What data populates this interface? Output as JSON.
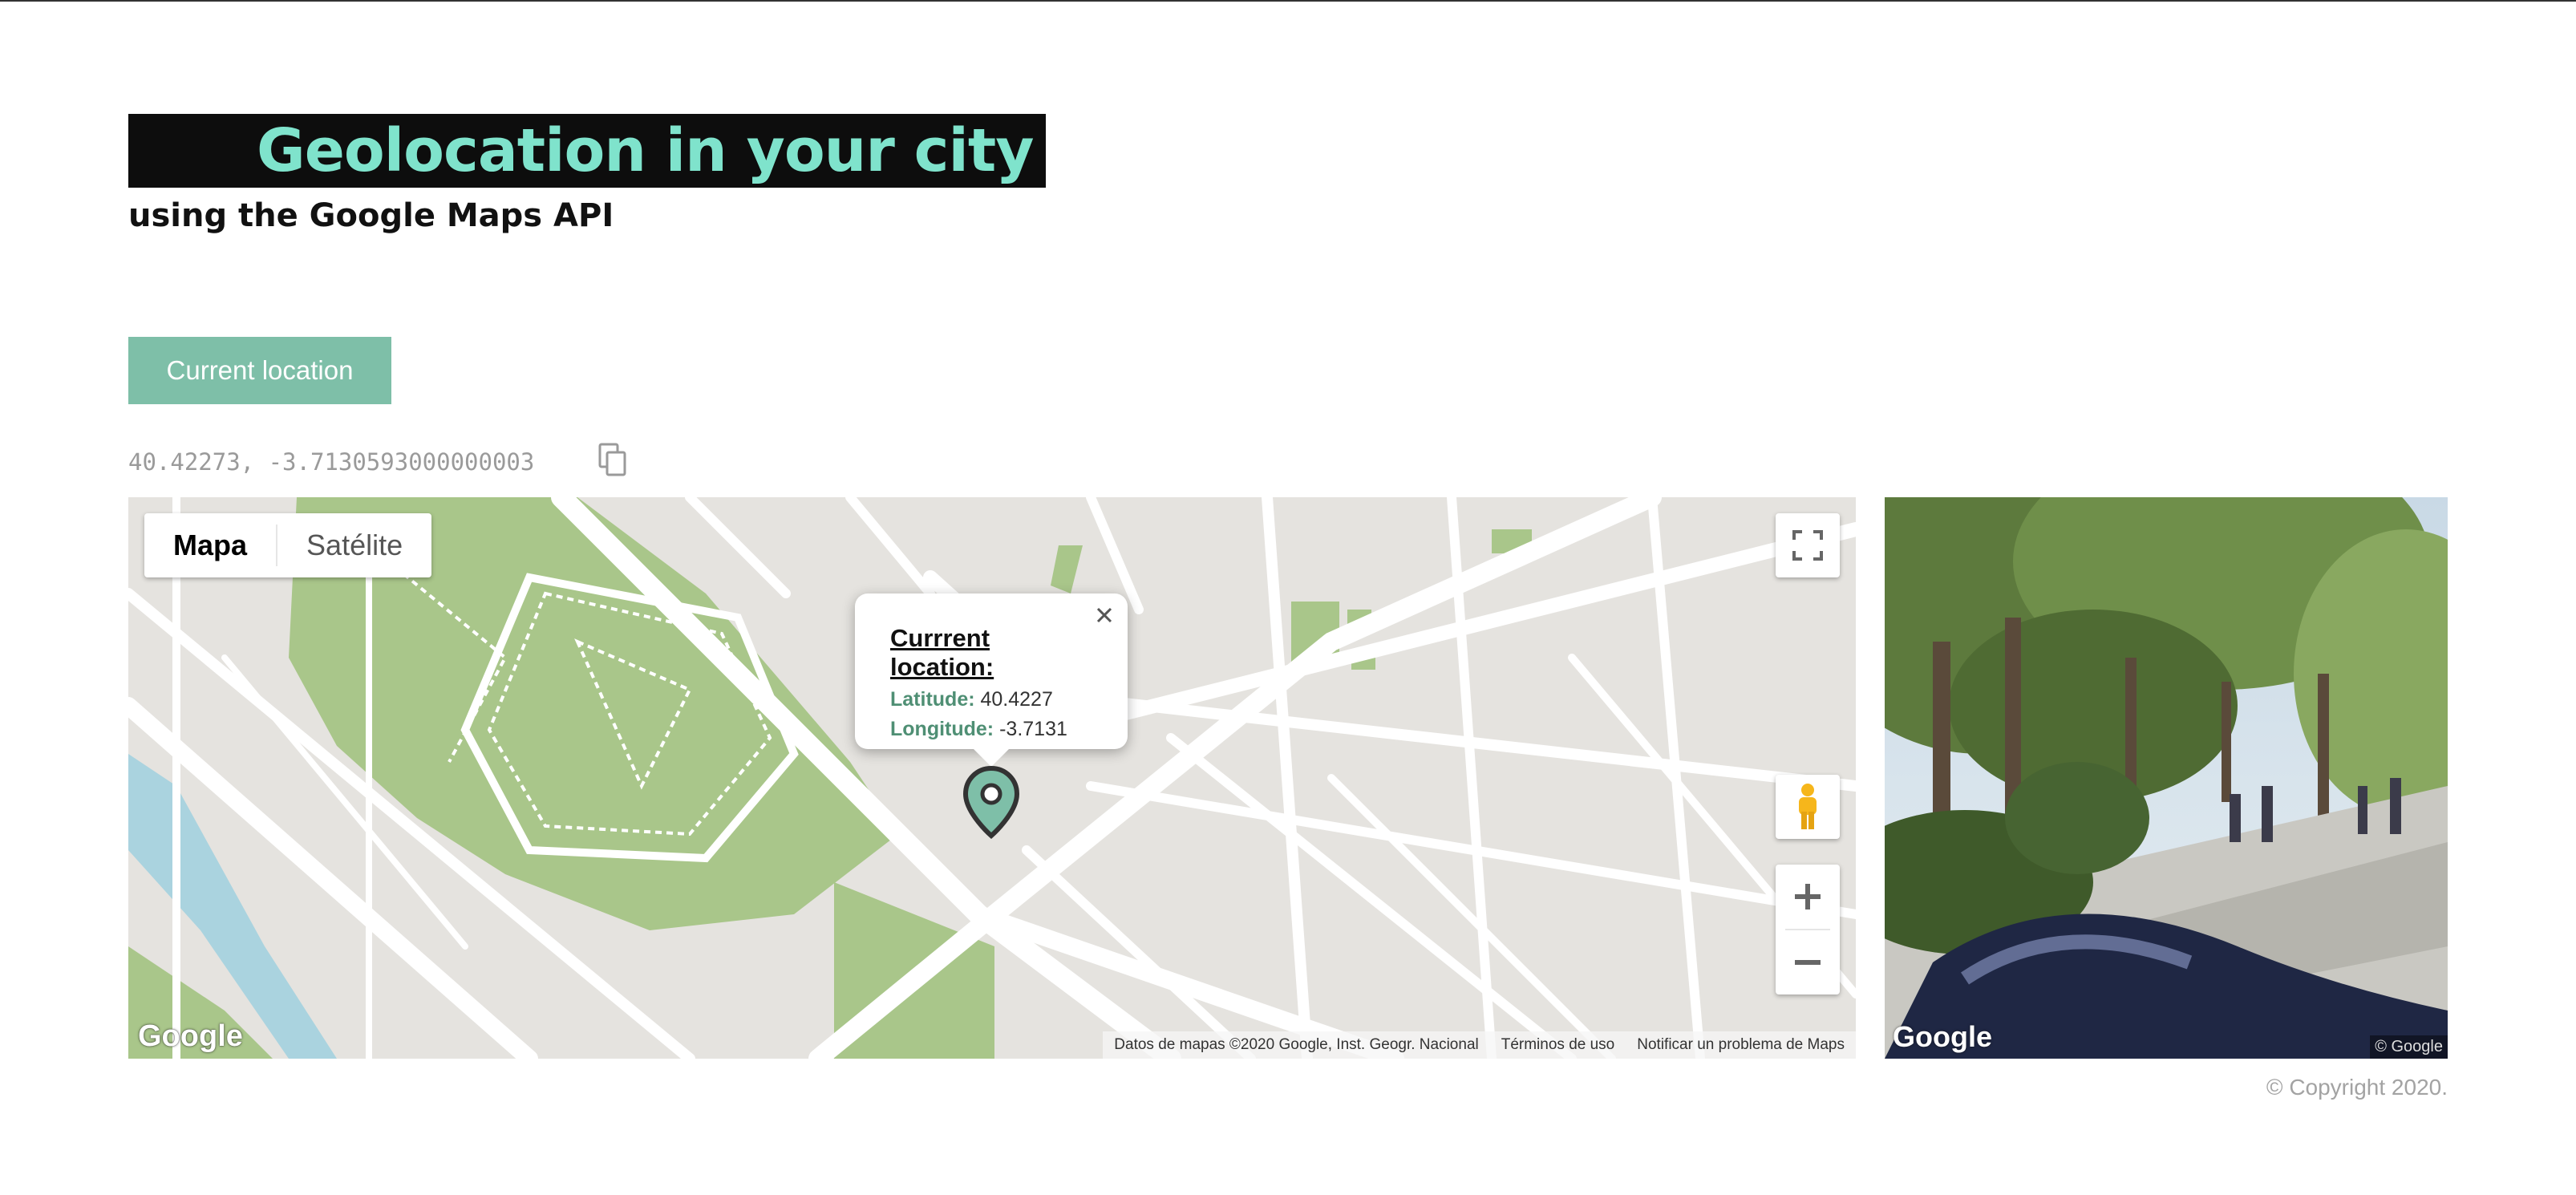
{
  "header": {
    "title": "Geolocation in your city",
    "subtitle": "using the Google Maps API"
  },
  "controls": {
    "current_location_label": "Current location",
    "coordinates_text": "40.42273, -3.7130593000000003"
  },
  "map": {
    "type_options": [
      "Mapa",
      "Satélite"
    ],
    "selected_type": "Mapa",
    "infowindow": {
      "title": "Currrent location:",
      "latitude_label": "Latitude:",
      "latitude_value": "40.4227",
      "longitude_label": "Longitude:",
      "longitude_value": "-3.7131"
    },
    "logo": "Google",
    "attribution": {
      "data": "Datos de mapas ©2020 Google, Inst. Geogr. Nacional",
      "terms": "Términos de uso",
      "report": "Notificar un problema de Maps"
    }
  },
  "streetview": {
    "logo": "Google",
    "copyright": "© Google"
  },
  "footer": {
    "copyright": "© Copyright 2020."
  },
  "colors": {
    "accent": "#7ebfa8",
    "title_text": "#7fe3cc",
    "title_bg": "#0d0d0d",
    "park": "#a9c68a",
    "water": "#aad3df",
    "map_bg": "#e5e3df"
  }
}
